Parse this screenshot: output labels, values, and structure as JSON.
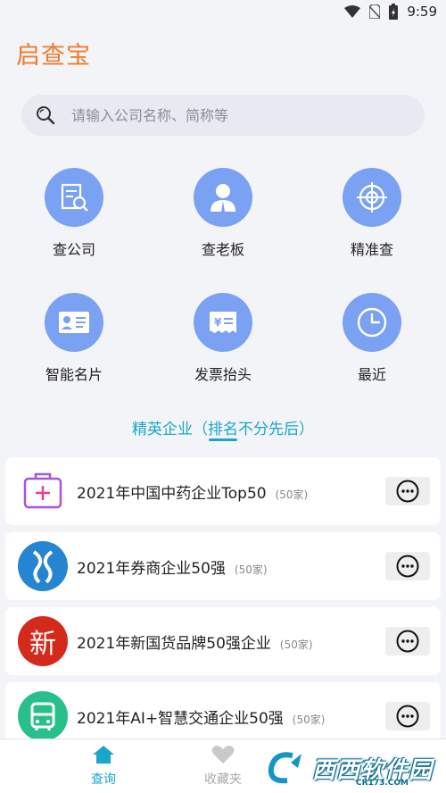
{
  "status_bar": {
    "time": "9:59"
  },
  "app": {
    "title": "启查宝"
  },
  "search": {
    "placeholder": "请输入公司名称、简称等"
  },
  "features": [
    {
      "label": "查公司",
      "icon": "document-search-icon"
    },
    {
      "label": "查老板",
      "icon": "person-icon"
    },
    {
      "label": "精准查",
      "icon": "target-icon"
    },
    {
      "label": "智能名片",
      "icon": "business-card-icon"
    },
    {
      "label": "发票抬头",
      "icon": "invoice-icon"
    },
    {
      "label": "最近",
      "icon": "clock-icon"
    }
  ],
  "section": {
    "title": "精英企业（排名不分先后）"
  },
  "lists": [
    {
      "name": "2021年中国中药企业Top50",
      "count": "(50家)",
      "icon": "medicine-kit-icon"
    },
    {
      "name": "2021年券商企业50强",
      "count": "(50家)",
      "icon": "broker-logo-icon"
    },
    {
      "name": "2021年新国货品牌50强企业",
      "count": "(50家)",
      "icon": "xin-character-icon"
    },
    {
      "name": "2021年AI+智慧交通企业50强",
      "count": "(50家)",
      "icon": "bus-icon"
    }
  ],
  "bottom_nav": [
    {
      "label": "查询",
      "icon": "home-icon",
      "active": true
    },
    {
      "label": "收藏夹",
      "icon": "heart-icon",
      "active": false
    }
  ],
  "watermark": {
    "text": "西西软件园",
    "sub": "CR173.COM"
  },
  "colors": {
    "accent": "#1aa6c8",
    "title": "#f07a2c",
    "icon_bg": "#7ba1f3"
  }
}
